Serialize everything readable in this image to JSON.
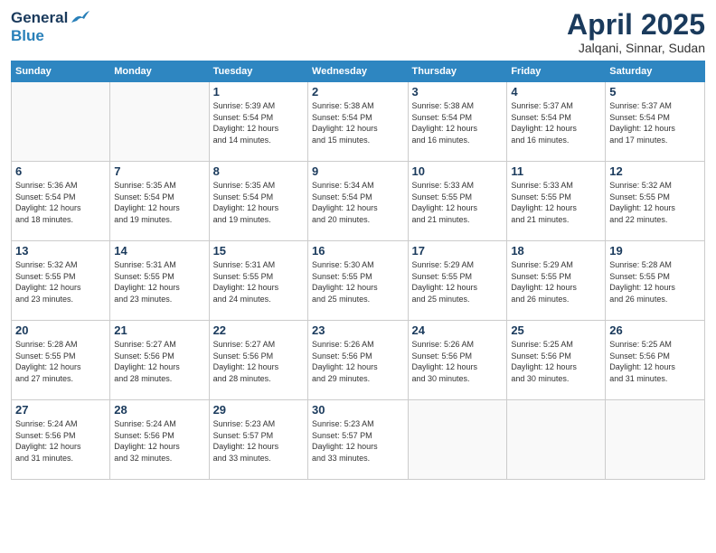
{
  "header": {
    "logo_general": "General",
    "logo_blue": "Blue",
    "month_title": "April 2025",
    "location": "Jalqani, Sinnar, Sudan"
  },
  "days_of_week": [
    "Sunday",
    "Monday",
    "Tuesday",
    "Wednesday",
    "Thursday",
    "Friday",
    "Saturday"
  ],
  "weeks": [
    [
      {
        "num": "",
        "detail": ""
      },
      {
        "num": "",
        "detail": ""
      },
      {
        "num": "1",
        "detail": "Sunrise: 5:39 AM\nSunset: 5:54 PM\nDaylight: 12 hours\nand 14 minutes."
      },
      {
        "num": "2",
        "detail": "Sunrise: 5:38 AM\nSunset: 5:54 PM\nDaylight: 12 hours\nand 15 minutes."
      },
      {
        "num": "3",
        "detail": "Sunrise: 5:38 AM\nSunset: 5:54 PM\nDaylight: 12 hours\nand 16 minutes."
      },
      {
        "num": "4",
        "detail": "Sunrise: 5:37 AM\nSunset: 5:54 PM\nDaylight: 12 hours\nand 16 minutes."
      },
      {
        "num": "5",
        "detail": "Sunrise: 5:37 AM\nSunset: 5:54 PM\nDaylight: 12 hours\nand 17 minutes."
      }
    ],
    [
      {
        "num": "6",
        "detail": "Sunrise: 5:36 AM\nSunset: 5:54 PM\nDaylight: 12 hours\nand 18 minutes."
      },
      {
        "num": "7",
        "detail": "Sunrise: 5:35 AM\nSunset: 5:54 PM\nDaylight: 12 hours\nand 19 minutes."
      },
      {
        "num": "8",
        "detail": "Sunrise: 5:35 AM\nSunset: 5:54 PM\nDaylight: 12 hours\nand 19 minutes."
      },
      {
        "num": "9",
        "detail": "Sunrise: 5:34 AM\nSunset: 5:54 PM\nDaylight: 12 hours\nand 20 minutes."
      },
      {
        "num": "10",
        "detail": "Sunrise: 5:33 AM\nSunset: 5:55 PM\nDaylight: 12 hours\nand 21 minutes."
      },
      {
        "num": "11",
        "detail": "Sunrise: 5:33 AM\nSunset: 5:55 PM\nDaylight: 12 hours\nand 21 minutes."
      },
      {
        "num": "12",
        "detail": "Sunrise: 5:32 AM\nSunset: 5:55 PM\nDaylight: 12 hours\nand 22 minutes."
      }
    ],
    [
      {
        "num": "13",
        "detail": "Sunrise: 5:32 AM\nSunset: 5:55 PM\nDaylight: 12 hours\nand 23 minutes."
      },
      {
        "num": "14",
        "detail": "Sunrise: 5:31 AM\nSunset: 5:55 PM\nDaylight: 12 hours\nand 23 minutes."
      },
      {
        "num": "15",
        "detail": "Sunrise: 5:31 AM\nSunset: 5:55 PM\nDaylight: 12 hours\nand 24 minutes."
      },
      {
        "num": "16",
        "detail": "Sunrise: 5:30 AM\nSunset: 5:55 PM\nDaylight: 12 hours\nand 25 minutes."
      },
      {
        "num": "17",
        "detail": "Sunrise: 5:29 AM\nSunset: 5:55 PM\nDaylight: 12 hours\nand 25 minutes."
      },
      {
        "num": "18",
        "detail": "Sunrise: 5:29 AM\nSunset: 5:55 PM\nDaylight: 12 hours\nand 26 minutes."
      },
      {
        "num": "19",
        "detail": "Sunrise: 5:28 AM\nSunset: 5:55 PM\nDaylight: 12 hours\nand 26 minutes."
      }
    ],
    [
      {
        "num": "20",
        "detail": "Sunrise: 5:28 AM\nSunset: 5:55 PM\nDaylight: 12 hours\nand 27 minutes."
      },
      {
        "num": "21",
        "detail": "Sunrise: 5:27 AM\nSunset: 5:56 PM\nDaylight: 12 hours\nand 28 minutes."
      },
      {
        "num": "22",
        "detail": "Sunrise: 5:27 AM\nSunset: 5:56 PM\nDaylight: 12 hours\nand 28 minutes."
      },
      {
        "num": "23",
        "detail": "Sunrise: 5:26 AM\nSunset: 5:56 PM\nDaylight: 12 hours\nand 29 minutes."
      },
      {
        "num": "24",
        "detail": "Sunrise: 5:26 AM\nSunset: 5:56 PM\nDaylight: 12 hours\nand 30 minutes."
      },
      {
        "num": "25",
        "detail": "Sunrise: 5:25 AM\nSunset: 5:56 PM\nDaylight: 12 hours\nand 30 minutes."
      },
      {
        "num": "26",
        "detail": "Sunrise: 5:25 AM\nSunset: 5:56 PM\nDaylight: 12 hours\nand 31 minutes."
      }
    ],
    [
      {
        "num": "27",
        "detail": "Sunrise: 5:24 AM\nSunset: 5:56 PM\nDaylight: 12 hours\nand 31 minutes."
      },
      {
        "num": "28",
        "detail": "Sunrise: 5:24 AM\nSunset: 5:56 PM\nDaylight: 12 hours\nand 32 minutes."
      },
      {
        "num": "29",
        "detail": "Sunrise: 5:23 AM\nSunset: 5:57 PM\nDaylight: 12 hours\nand 33 minutes."
      },
      {
        "num": "30",
        "detail": "Sunrise: 5:23 AM\nSunset: 5:57 PM\nDaylight: 12 hours\nand 33 minutes."
      },
      {
        "num": "",
        "detail": ""
      },
      {
        "num": "",
        "detail": ""
      },
      {
        "num": "",
        "detail": ""
      }
    ]
  ]
}
